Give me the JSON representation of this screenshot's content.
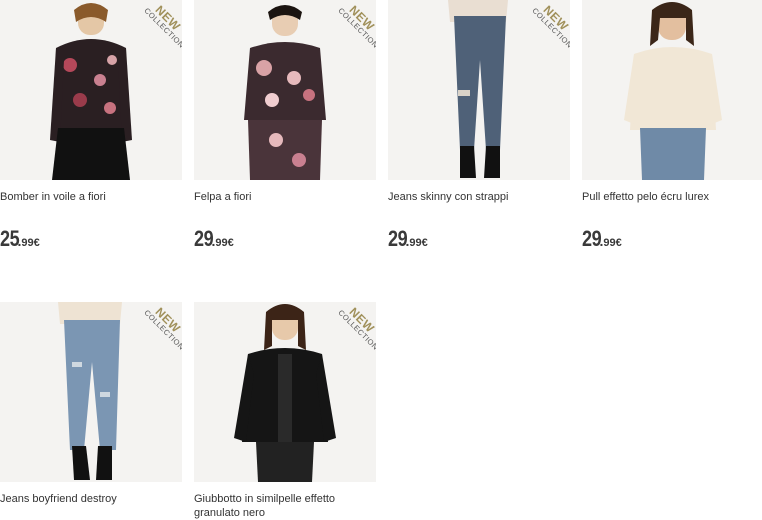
{
  "products": [
    {
      "name": "Bomber in voile a fiori",
      "price_int": "25",
      "price_sep": ".",
      "price_dec": "99€",
      "badge_new": "NEW",
      "badge_collection": "COLLECTION*",
      "has_badge": true
    },
    {
      "name": "Felpa a fiori",
      "price_int": "29",
      "price_sep": ".",
      "price_dec": "99€",
      "badge_new": "NEW",
      "badge_collection": "COLLECTION*",
      "has_badge": true
    },
    {
      "name": "Jeans skinny con strappi",
      "price_int": "29",
      "price_sep": ".",
      "price_dec": "99€",
      "badge_new": "NEW",
      "badge_collection": "COLLECTION*",
      "has_badge": true
    },
    {
      "name": "Pull effetto pelo écru lurex",
      "price_int": "29",
      "price_sep": ".",
      "price_dec": "99€",
      "has_badge": false
    },
    {
      "name": "Jeans boyfriend destroy",
      "has_badge": true,
      "badge_new": "NEW",
      "badge_collection": "COLLECTION*"
    },
    {
      "name": "Giubbotto in similpelle effetto granulato nero",
      "has_badge": true,
      "badge_new": "NEW",
      "badge_collection": "COLLECTION*"
    }
  ],
  "colors": {
    "badge_gold": "#a0905a",
    "photo_bg": "#f4f3f1",
    "text": "#333333"
  }
}
